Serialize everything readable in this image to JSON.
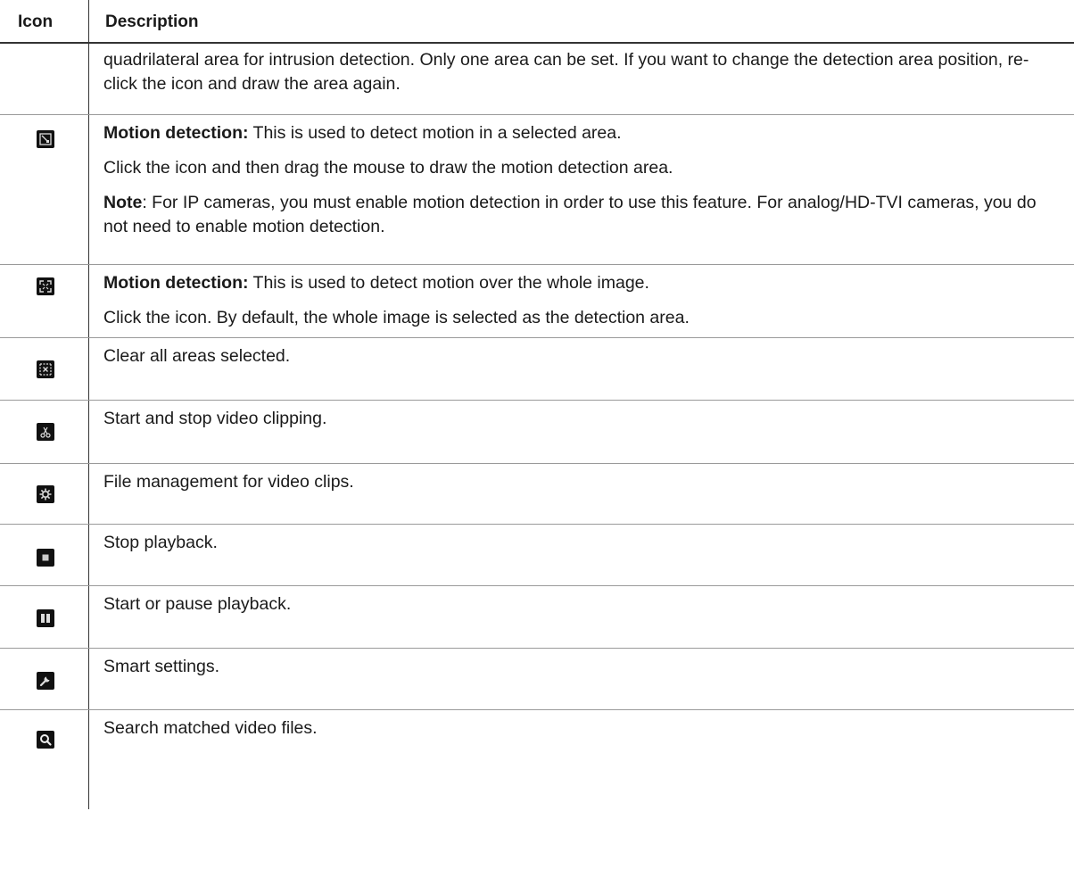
{
  "header": {
    "icon_col": "Icon",
    "desc_col": "Description"
  },
  "rows": [
    {
      "icon": "",
      "paragraphs": [
        {
          "bold": "",
          "text": "quadrilateral area for intrusion detection. Only one area can be set. If you want to change the detection area position, re-click the icon and draw the area again."
        }
      ]
    },
    {
      "icon": "motion-detection-area-icon",
      "paragraphs": [
        {
          "bold": "Motion detection:",
          "text": "  This is used to detect motion in a selected area."
        },
        {
          "bold": "",
          "text": "Click the icon and then drag the mouse to draw the motion detection area."
        },
        {
          "bold": "Note",
          "text": ": For IP cameras, you must enable motion detection in order to use this feature. For analog/HD-TVI cameras, you do not need to enable motion detection."
        }
      ]
    },
    {
      "icon": "fullscreen-detection-icon",
      "paragraphs": [
        {
          "bold": "Motion detection:",
          "text": " This is used to detect motion over the whole image."
        },
        {
          "bold": "",
          "text": "Click the icon. By default, the whole image is selected as the detection area."
        }
      ]
    },
    {
      "icon": "clear-areas-icon",
      "paragraphs": [
        {
          "bold": "",
          "text": "Clear all areas selected."
        }
      ]
    },
    {
      "icon": "scissors-icon",
      "paragraphs": [
        {
          "bold": "",
          "text": "Start and stop video clipping."
        }
      ]
    },
    {
      "icon": "gear-icon",
      "paragraphs": [
        {
          "bold": "",
          "text": "File management for video clips."
        }
      ]
    },
    {
      "icon": "stop-icon",
      "paragraphs": [
        {
          "bold": "",
          "text": "Stop playback."
        }
      ]
    },
    {
      "icon": "pause-icon",
      "paragraphs": [
        {
          "bold": "",
          "text": "Start or pause playback."
        }
      ]
    },
    {
      "icon": "wrench-icon",
      "paragraphs": [
        {
          "bold": "",
          "text": "Smart settings."
        }
      ]
    },
    {
      "icon": "search-icon",
      "paragraphs": [
        {
          "bold": "",
          "text": "Search matched video files."
        }
      ]
    }
  ]
}
